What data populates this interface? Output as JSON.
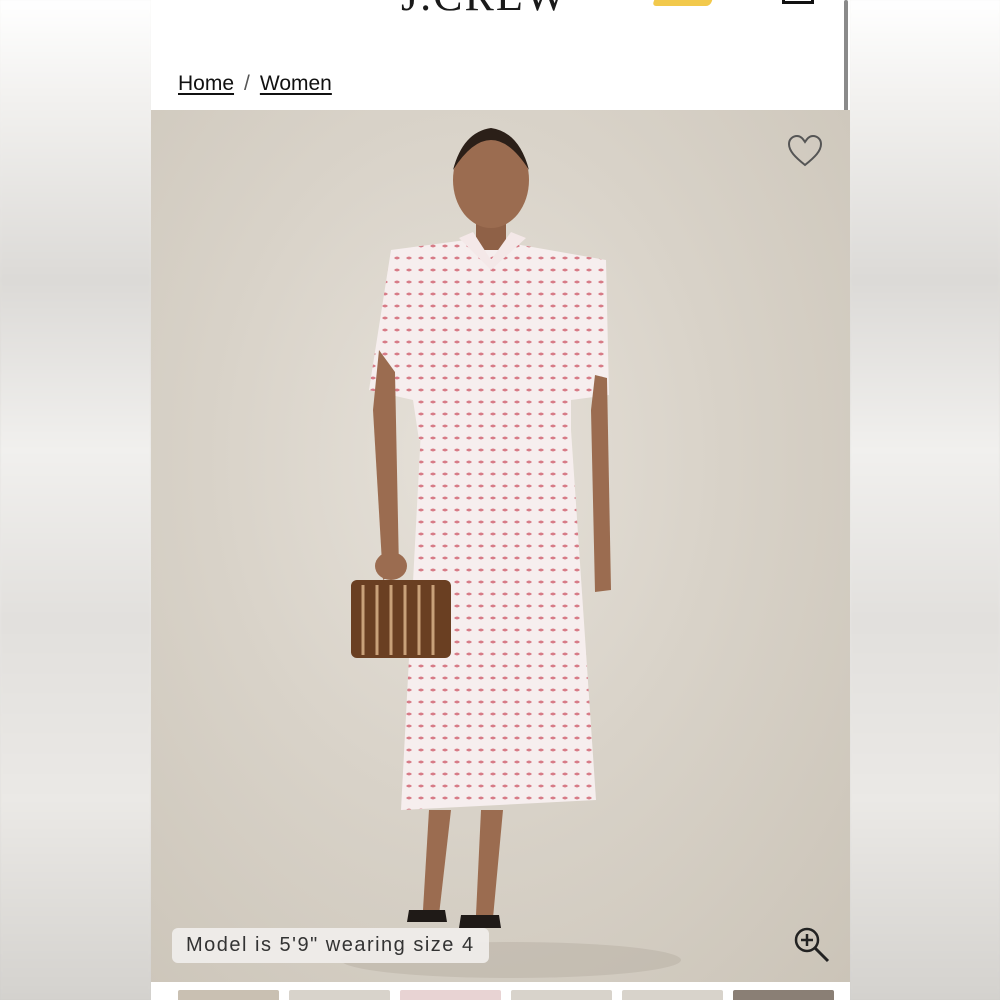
{
  "header": {
    "logo_text": "J.CREW"
  },
  "breadcrumb": {
    "items": [
      "Home",
      "Women"
    ],
    "separator": "/"
  },
  "product": {
    "model_note": "Model is 5'9\" wearing size 4",
    "wishlist_icon": "heart-icon",
    "zoom_icon": "zoom-in-icon",
    "thumbnail_count": 6
  },
  "colors": {
    "brand_yellow": "#f2c94c",
    "dress_pink": "#e9a9b0"
  }
}
